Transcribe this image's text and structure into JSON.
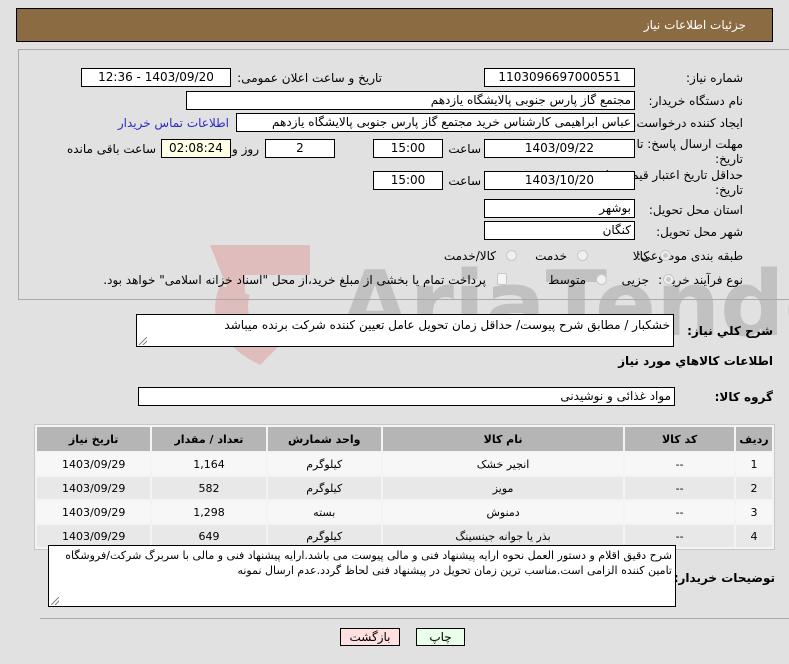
{
  "header": {
    "title": "جزئیات اطلاعات نیاز"
  },
  "form": {
    "need_number": {
      "label": "شماره نیاز:",
      "value": "1103096697000551"
    },
    "announce_datetime": {
      "label": "تاریخ و ساعت اعلان عمومی:",
      "value": "1403/09/20 - 12:36"
    },
    "buyer_org": {
      "label": "نام دستگاه خریدار:",
      "value": "مجتمع گاز پارس جنوبی  پالایشگاه یازدهم"
    },
    "requester": {
      "label": "ایجاد کننده درخواست:",
      "value": "عباس ابراهیمی کارشناس خرید مجتمع گاز پارس جنوبی  پالایشگاه یازدهم",
      "contact_link": "اطلاعات تماس خریدار"
    },
    "reply_deadline": {
      "label_line1": "مهلت ارسال پاسخ: تا",
      "label_line2": "تاریخ:",
      "date": "1403/09/22",
      "time_label": "ساعت",
      "time": "15:00",
      "days": "2",
      "days_label": "روز و",
      "remaining": "02:08:24",
      "remaining_label": "ساعت باقی مانده"
    },
    "price_validity": {
      "label_line1": "حداقل تاریخ اعتبار قیمت: تا",
      "label_line2": "تاریخ:",
      "date": "1403/10/20",
      "time_label": "ساعت",
      "time": "15:00"
    },
    "province": {
      "label": "استان محل تحویل:",
      "value": "بوشهر"
    },
    "city": {
      "label": "شهر محل تحویل:",
      "value": "کنگان"
    },
    "category": {
      "label": "طبقه بندی موضوعی:",
      "options": [
        {
          "label": "کالا",
          "checked": true
        },
        {
          "label": "خدمت",
          "checked": false
        },
        {
          "label": "کالا/خدمت",
          "checked": false
        }
      ]
    },
    "purchase_type": {
      "label": "نوع فرآیند خرید :",
      "options": [
        {
          "label": "جزیی",
          "checked": true
        },
        {
          "label": "متوسط",
          "checked": false
        }
      ],
      "treasury_checkbox": {
        "label": "پرداخت تمام یا بخشی از مبلغ خرید،از محل \"اسناد خزانه اسلامی\" خواهد بود.",
        "checked": false
      }
    }
  },
  "description": {
    "label": "شرح کلي نیاز:",
    "value": "خشکبار / مطابق شرح پیوست/ حداقل زمان تحویل عامل تعیین کننده شرکت برنده میباشد"
  },
  "goods_section": {
    "title": "اطلاعات کالاهاي مورد نیاز"
  },
  "goods_group": {
    "label": "گروه کالا:",
    "value": "مواد غذائی و نوشیدنی"
  },
  "table": {
    "headers": [
      "ردیف",
      "کد کالا",
      "نام کالا",
      "واحد شمارش",
      "تعداد / مقدار",
      "تاریخ نیاز"
    ],
    "rows": [
      [
        "1",
        "--",
        "انجیر خشک",
        "کیلوگرم",
        "1,164",
        "1403/09/29"
      ],
      [
        "2",
        "--",
        "مویز",
        "کیلوگرم",
        "582",
        "1403/09/29"
      ],
      [
        "3",
        "--",
        "دمنوش",
        "بسته",
        "1,298",
        "1403/09/29"
      ],
      [
        "4",
        "--",
        "بذر یا جوانه جینسینگ",
        "کیلوگرم",
        "649",
        "1403/09/29"
      ]
    ]
  },
  "buyer_notes": {
    "label": "توضیحات خریدار:",
    "value": "شرح دقیق اقلام و دستور العمل نحوه ارایه پیشنهاد فنی و مالی پیوست می باشد.ارایه پیشنهاد فنی و مالی با سربرگ شرکت/فروشگاه تامین کننده الزامی است.مناسب ترین زمان تحویل در پیشنهاد فنی لحاظ گردد.عدم ارسال نمونه"
  },
  "buttons": {
    "print": "چاپ",
    "back": "بازگشت"
  },
  "colors": {
    "header_bg": "#8b6b42",
    "print_bg": "#eaffea",
    "back_bg": "#ffe0e0",
    "link": "#2b2bc8"
  }
}
